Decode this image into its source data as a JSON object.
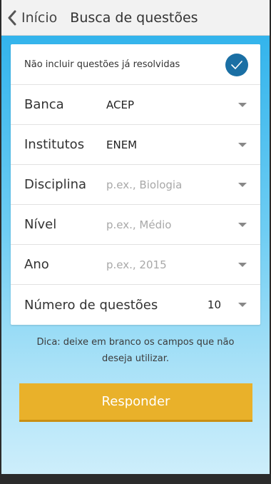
{
  "header": {
    "back_label": "Início",
    "title": "Busca de questões"
  },
  "filter": {
    "exclude_solved_label": "Não incluir questões já resolvidas",
    "exclude_solved_checked": true
  },
  "fields": [
    {
      "label": "Banca",
      "value": "ACEP",
      "placeholder": ""
    },
    {
      "label": "Institutos",
      "value": "ENEM",
      "placeholder": ""
    },
    {
      "label": "Disciplina",
      "value": "",
      "placeholder": "p.ex., Biologia"
    },
    {
      "label": "Nível",
      "value": "",
      "placeholder": "p.ex., Médio"
    },
    {
      "label": "Ano",
      "value": "",
      "placeholder": "p.ex., 2015"
    }
  ],
  "question_count": {
    "label": "Número de questões",
    "value": "10"
  },
  "hint": {
    "line1": "Dica: deixe em branco os campos que não",
    "line2": "deseja utilizar."
  },
  "submit_label": "Responder",
  "colors": {
    "accent_button": "#e9b12a",
    "check_circle": "#1a6fa4",
    "background_top": "#33b4ec"
  }
}
